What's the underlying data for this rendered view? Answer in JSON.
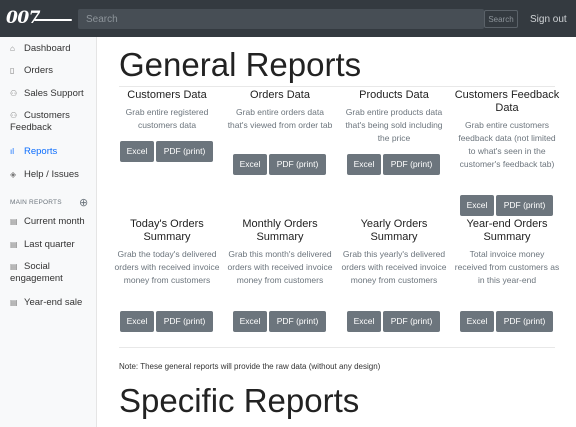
{
  "navbar": {
    "logo_text": "007",
    "search_placeholder": "Search",
    "search_button": "Search",
    "signout": "Sign out"
  },
  "sidebar": {
    "items": [
      {
        "label": "Dashboard",
        "icon": "home-icon"
      },
      {
        "label": "Orders",
        "icon": "file-icon"
      },
      {
        "label": "Sales Support",
        "icon": "users-icon"
      },
      {
        "label": "Customers Feedback",
        "icon": "users-icon"
      },
      {
        "label": "Reports",
        "icon": "bar-chart-icon",
        "active": true
      },
      {
        "label": "Help / Issues",
        "icon": "layers-icon"
      }
    ],
    "heading": "MAIN REPORTS",
    "reports": [
      {
        "label": "Current month",
        "icon": "file-text-icon"
      },
      {
        "label": "Last quarter",
        "icon": "file-text-icon"
      },
      {
        "label": "Social engagement",
        "icon": "file-text-icon"
      },
      {
        "label": "Year-end sale",
        "icon": "file-text-icon"
      }
    ]
  },
  "main": {
    "title": "General Reports",
    "cards": [
      {
        "title": "Customers Data",
        "desc": "Grab entire registered customers data"
      },
      {
        "title": "Orders Data",
        "desc": "Grab entire orders data that's viewed from order tab"
      },
      {
        "title": "Products Data",
        "desc": "Grab entire products data that's being sold including the price"
      },
      {
        "title": "Customers Feedback Data",
        "desc": "Grab entire customers feedback data (not limited to what's seen in the customer's feedback tab)"
      },
      {
        "title": "Today's Orders Summary",
        "desc": "Grab the today's delivered orders with received invoice money from customers"
      },
      {
        "title": "Monthly Orders Summary",
        "desc": "Grab this month's delivered orders with received invoice money from customers"
      },
      {
        "title": "Yearly Orders Summary",
        "desc": "Grab this yearly's delivered orders with received invoice money from customers"
      },
      {
        "title": "Year-end Orders Summary",
        "desc": "Total invoice money received from customers as in this year-end"
      }
    ],
    "excel_label": "Excel",
    "pdf_label": "PDF (print)",
    "note": "Note: These general reports will provide the raw data (without any design)",
    "title2": "Specific Reports"
  },
  "colors": {
    "navbar_bg": "#343a40",
    "button_bg": "#6c757d",
    "active_link": "#0d6efd"
  }
}
